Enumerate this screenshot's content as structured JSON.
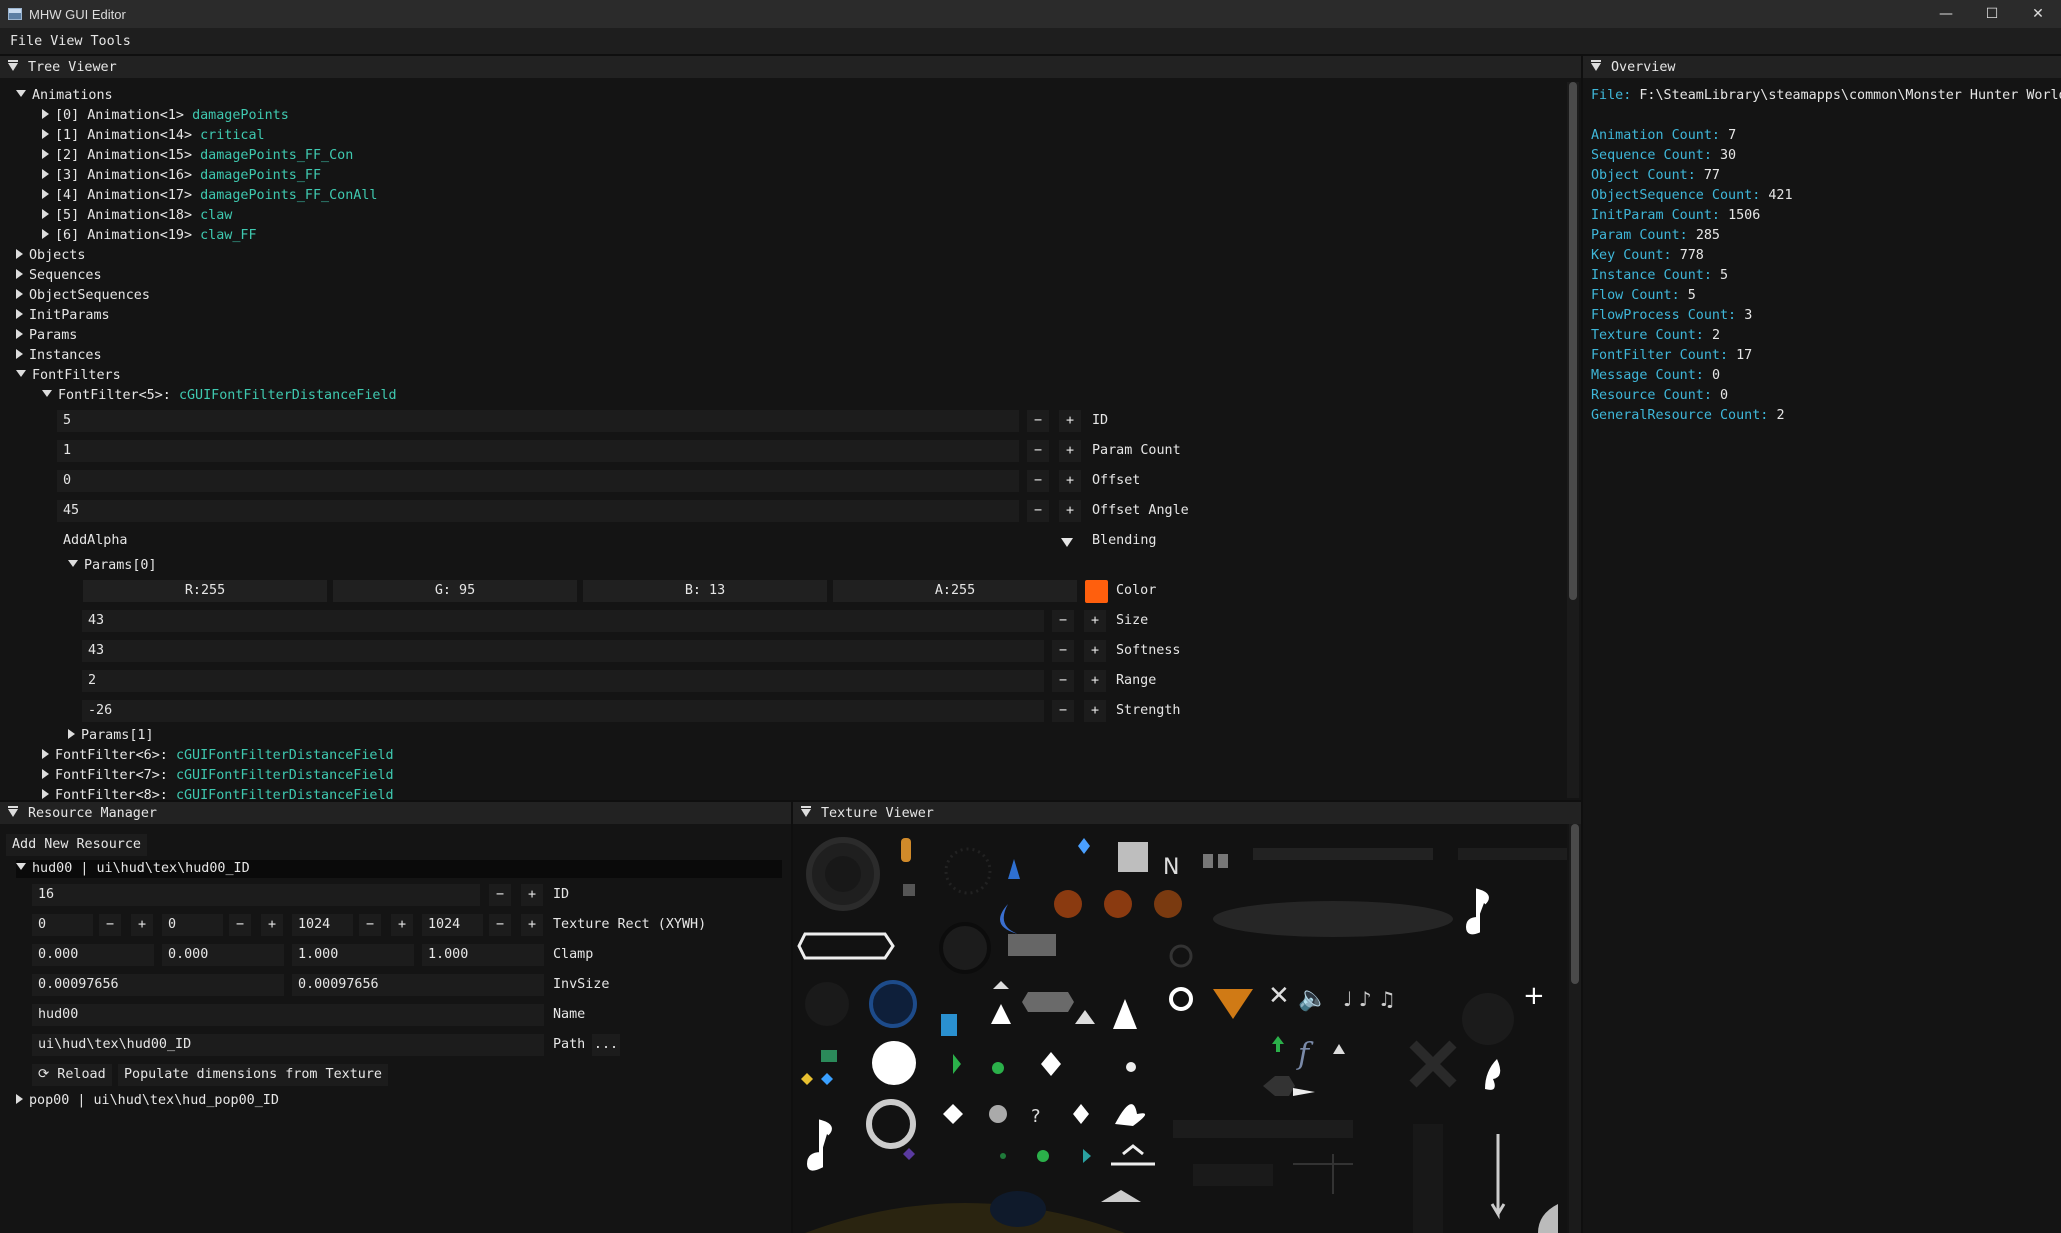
{
  "window": {
    "title": "MHW GUI Editor"
  },
  "menu": [
    "File",
    "View",
    "Tools"
  ],
  "tree_viewer": {
    "title": "Tree Viewer",
    "animations_label": "Animations",
    "animations": [
      {
        "index": "[0]",
        "name": "Animation<1>",
        "type": "damagePoints"
      },
      {
        "index": "[1]",
        "name": "Animation<14>",
        "type": "critical"
      },
      {
        "index": "[2]",
        "name": "Animation<15>",
        "type": "damagePoints_FF_Con"
      },
      {
        "index": "[3]",
        "name": "Animation<16>",
        "type": "damagePoints_FF"
      },
      {
        "index": "[4]",
        "name": "Animation<17>",
        "type": "damagePoints_FF_ConAll"
      },
      {
        "index": "[5]",
        "name": "Animation<18>",
        "type": "claw"
      },
      {
        "index": "[6]",
        "name": "Animation<19>",
        "type": "claw_FF"
      }
    ],
    "sections": [
      "Objects",
      "Sequences",
      "ObjectSequences",
      "InitParams",
      "Params",
      "Instances"
    ],
    "fontfilters_label": "FontFilters",
    "fontfilter_open": {
      "name": "FontFilter<5>:",
      "type": "cGUIFontFilterDistanceField"
    },
    "fields": [
      {
        "value": "5",
        "label": "ID"
      },
      {
        "value": "1",
        "label": "Param Count"
      },
      {
        "value": "0",
        "label": "Offset"
      },
      {
        "value": "45",
        "label": "Offset Angle"
      }
    ],
    "blending": {
      "value": "AddAlpha",
      "label": "Blending"
    },
    "params0_label": "Params[0]",
    "color": {
      "r": "R:255",
      "g": "G: 95",
      "b": "B: 13",
      "a": "A:255",
      "label": "Color",
      "swatch": "#ff5f0d"
    },
    "param_fields": [
      {
        "value": "43",
        "label": "Size"
      },
      {
        "value": "43",
        "label": "Softness"
      },
      {
        "value": "2",
        "label": "Range"
      },
      {
        "value": "-26",
        "label": "Strength"
      }
    ],
    "params1_label": "Params[1]",
    "fontfilters_more": [
      {
        "name": "FontFilter<6>:",
        "type": "cGUIFontFilterDistanceField"
      },
      {
        "name": "FontFilter<7>:",
        "type": "cGUIFontFilterDistanceField"
      },
      {
        "name": "FontFilter<8>:",
        "type": "cGUIFontFilterDistanceField"
      }
    ]
  },
  "overview": {
    "title": "Overview",
    "file_label": "File:",
    "file_path": "F:\\SteamLibrary\\steamapps\\common\\Monster Hunter World",
    "counts": [
      {
        "key": "Animation Count:",
        "value": "7"
      },
      {
        "key": "Sequence Count:",
        "value": "30"
      },
      {
        "key": "Object Count:",
        "value": "77"
      },
      {
        "key": "ObjectSequence Count:",
        "value": "421"
      },
      {
        "key": "InitParam Count:",
        "value": "1506"
      },
      {
        "key": "Param Count:",
        "value": "285"
      },
      {
        "key": "Key Count:",
        "value": "778"
      },
      {
        "key": "Instance Count:",
        "value": "5"
      },
      {
        "key": "Flow Count:",
        "value": "5"
      },
      {
        "key": "FlowProcess Count:",
        "value": "3"
      },
      {
        "key": "Texture Count:",
        "value": "2"
      },
      {
        "key": "FontFilter Count:",
        "value": "17"
      },
      {
        "key": "Message Count:",
        "value": "0"
      },
      {
        "key": "Resource Count:",
        "value": "0"
      },
      {
        "key": "GeneralResource Count:",
        "value": "2"
      }
    ]
  },
  "resource_manager": {
    "title": "Resource Manager",
    "add_button": "Add New Resource",
    "resource_open": "hud00 | ui\\hud\\tex\\hud00_ID",
    "id": {
      "value": "16",
      "label": "ID"
    },
    "rect": {
      "x": "0",
      "y": "0",
      "w": "1024",
      "h": "1024",
      "label": "Texture Rect (XYWH)"
    },
    "clamp": {
      "a": "0.000",
      "b": "0.000",
      "c": "1.000",
      "d": "1.000",
      "label": "Clamp"
    },
    "invsize": {
      "a": "0.00097656",
      "b": "0.00097656",
      "label": "InvSize"
    },
    "name": {
      "value": "hud00",
      "label": "Name"
    },
    "path": {
      "value": "ui\\hud\\tex\\hud00_ID",
      "label": "Path",
      "browse": "..."
    },
    "reload": "Reload",
    "populate": "Populate dimensions from Texture",
    "resource_closed": "pop00 | ui\\hud\\tex\\hud_pop00_ID"
  },
  "texture_viewer": {
    "title": "Texture Viewer"
  },
  "glyphs": {
    "minus": "−",
    "plus": "+",
    "minimize": "—",
    "maximize": "☐",
    "close": "✕"
  }
}
